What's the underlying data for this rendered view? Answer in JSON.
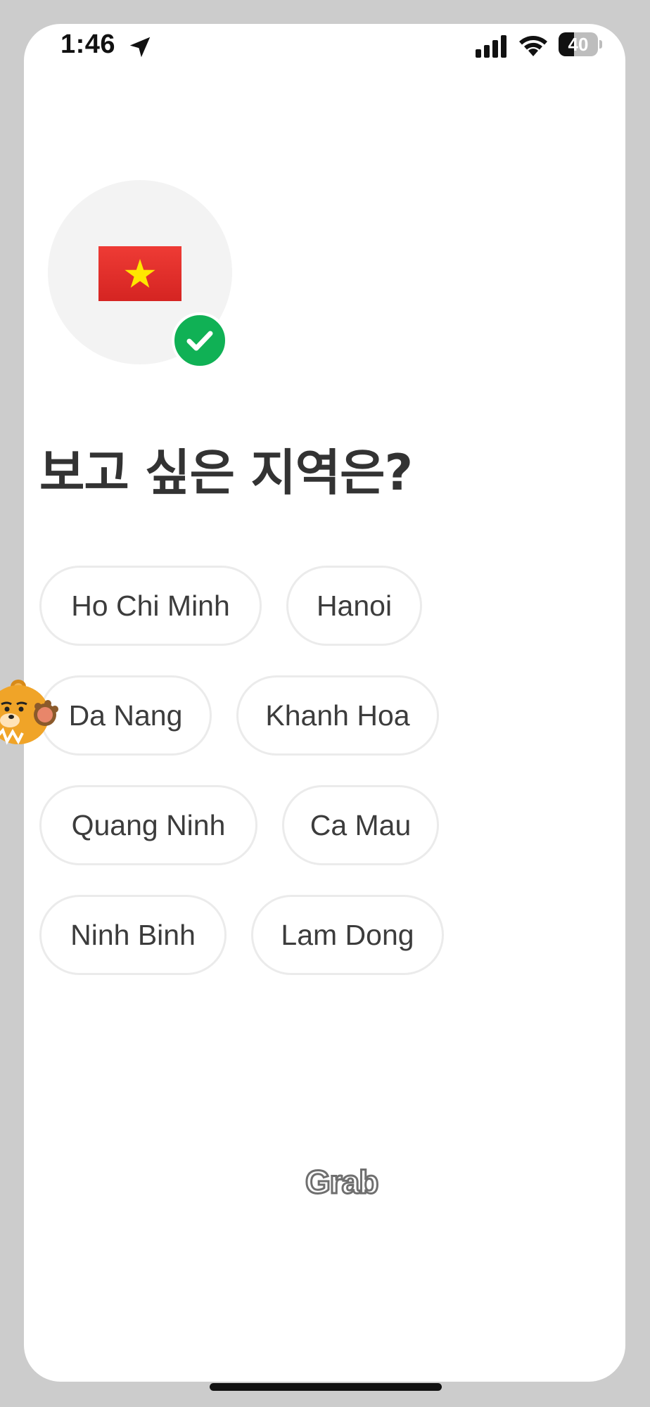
{
  "status_bar": {
    "time": "1:46",
    "battery": "40",
    "battery_level": 0.4,
    "icons": [
      "location-arrow-icon",
      "cellular-signal-icon",
      "wifi-icon",
      "battery-icon"
    ]
  },
  "header": {
    "flag": "vietnam-flag-icon",
    "selected_badge": "check-icon",
    "title": "보고 싶은 지역은?"
  },
  "regions": [
    {
      "label": "Ho Chi Minh"
    },
    {
      "label": "Hanoi"
    },
    {
      "label": "Da Nang"
    },
    {
      "label": "Khanh Hoa"
    },
    {
      "label": "Quang Ninh"
    },
    {
      "label": "Ca Mau"
    },
    {
      "label": "Ninh Binh"
    },
    {
      "label": "Lam Dong"
    }
  ],
  "footer": {
    "logo": "Grab"
  },
  "colors": {
    "check_badge": "#10b155",
    "flag_red": "#da251d",
    "flag_star": "#ffe600",
    "chip_border": "#ebebeb",
    "heading_text": "#333333",
    "background_frame": "#cccccc"
  }
}
